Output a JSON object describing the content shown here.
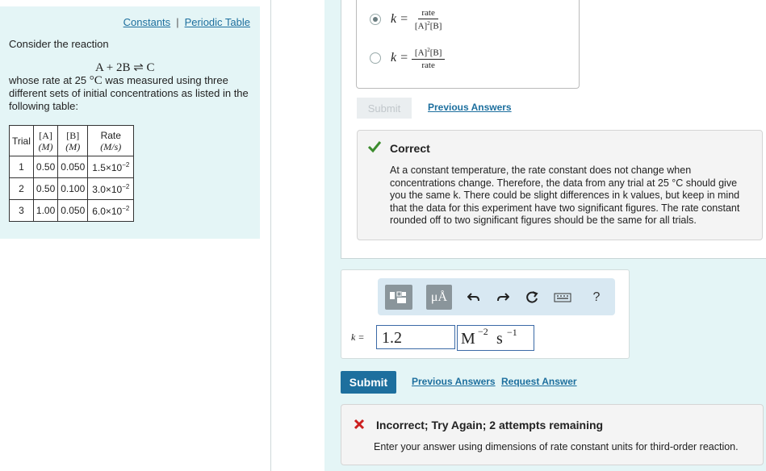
{
  "left": {
    "links": {
      "constants": "Constants",
      "separator": "|",
      "periodic_table": "Periodic Table"
    },
    "intro": "Consider the reaction",
    "reaction": "A + 2B ⇌ C",
    "desc_prefix": "whose rate at 25 ",
    "desc_deg": "°C",
    "desc_suffix": " was measured using three different sets of initial concentrations as listed in the following table:",
    "table": {
      "headers": {
        "trial": "Trial",
        "a_top": "[A]",
        "a_unit": "(M)",
        "b_top": "[B]",
        "b_unit": "(M)",
        "rate_top": "Rate",
        "rate_unit": "(M/s)"
      },
      "rows": [
        {
          "trial": "1",
          "a": "0.50",
          "b": "0.050",
          "rate_mant": "1.5×10",
          "rate_exp": "−2"
        },
        {
          "trial": "2",
          "a": "0.50",
          "b": "0.100",
          "rate_mant": "3.0×10",
          "rate_exp": "−2"
        },
        {
          "trial": "3",
          "a": "1.00",
          "b": "0.050",
          "rate_mant": "6.0×10",
          "rate_exp": "−2"
        }
      ]
    }
  },
  "choices": {
    "k_eq": "k =",
    "option1": {
      "num": "rate",
      "den_a": "[A]",
      "den_exp": "2",
      "den_b": "[B]",
      "selected": true
    },
    "option2": {
      "num_a": "[A]",
      "num_exp": "2",
      "num_b": "[B]",
      "den": "rate",
      "selected": false
    }
  },
  "part1": {
    "submit_label": "Submit",
    "previous_answers": "Previous Answers"
  },
  "feedback_correct": {
    "title": "Correct",
    "message": "At a constant temperature, the rate constant does not change when concentrations change. Therefore, the data from any trial at 25 °C should give you the same k. There could be slight differences in k values, but keep in mind that the data for this experiment have two significant figures. The rate constant rounded off to two significant figures should be the same for all trials.",
    "accent": "#3c8c2e"
  },
  "editor": {
    "toolbar": {
      "mu_label": "μÅ",
      "help_label": "?"
    },
    "k_label": "k =",
    "k_value": "1.2",
    "units": {
      "m": "M",
      "m_exp": "−2",
      "s": "s",
      "s_exp": "−1"
    }
  },
  "part2": {
    "submit_label": "Submit",
    "previous_answers": "Previous Answers",
    "request_answer": "Request Answer"
  },
  "feedback_incorrect": {
    "title": "Incorrect; Try Again; 2 attempts remaining",
    "message": "Enter your answer using dimensions of rate constant units for third-order reaction.",
    "accent": "#cc1f1f"
  }
}
